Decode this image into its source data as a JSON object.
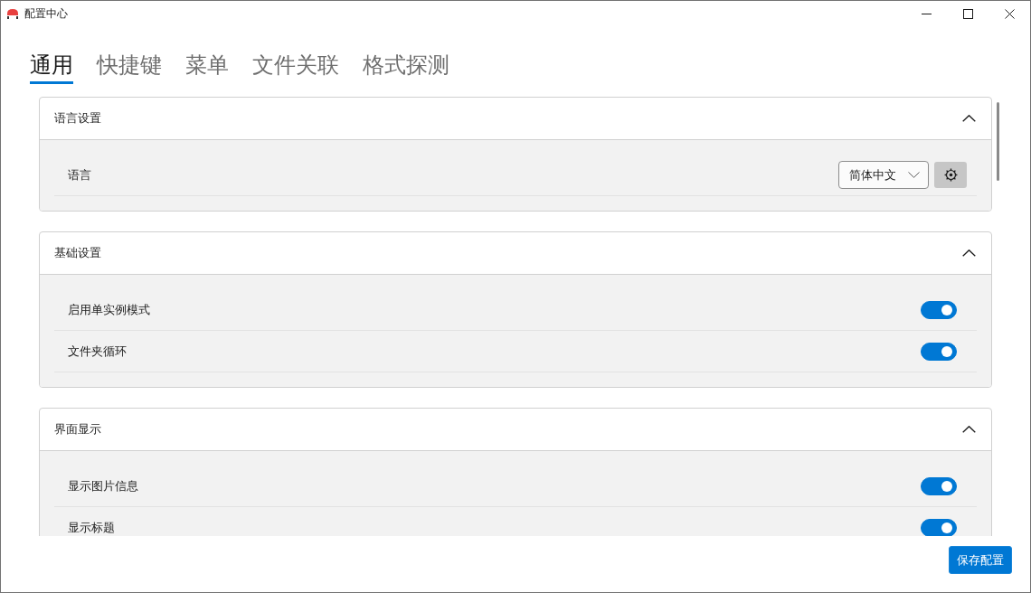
{
  "window": {
    "title": "配置中心"
  },
  "tabs": [
    {
      "label": "通用",
      "selected": true
    },
    {
      "label": "快捷键",
      "selected": false
    },
    {
      "label": "菜单",
      "selected": false
    },
    {
      "label": "文件关联",
      "selected": false
    },
    {
      "label": "格式探测",
      "selected": false
    }
  ],
  "sections": [
    {
      "title": "语言设置",
      "expanded": true,
      "rows": [
        {
          "kind": "select",
          "label": "语言",
          "value": "简体中文"
        }
      ]
    },
    {
      "title": "基础设置",
      "expanded": true,
      "rows": [
        {
          "kind": "toggle",
          "label": "启用单实例模式",
          "on": true
        },
        {
          "kind": "toggle",
          "label": "文件夹循环",
          "on": true
        }
      ]
    },
    {
      "title": "界面显示",
      "expanded": true,
      "rows": [
        {
          "kind": "toggle",
          "label": "显示图片信息",
          "on": true
        },
        {
          "kind": "toggle",
          "label": "显示标题",
          "on": true
        }
      ]
    }
  ],
  "save_button": {
    "label": "保存配置"
  }
}
